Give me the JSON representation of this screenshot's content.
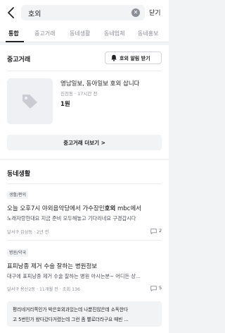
{
  "search": {
    "query": "호외",
    "close_label": "닫기"
  },
  "tabs": [
    {
      "label": "통합",
      "active": true
    },
    {
      "label": "중고거래",
      "active": false
    },
    {
      "label": "동네생활",
      "active": false
    },
    {
      "label": "동네업체",
      "active": false
    },
    {
      "label": "동네홍보",
      "active": false
    }
  ],
  "used_trade": {
    "section_title": "중고거래",
    "alert_button": "호외 알림 받기",
    "item": {
      "title": "영남일보, 동아일보 호외 삽니다",
      "meta": "진천동 · 17시간 전",
      "price": "1원"
    },
    "more_button": "중고거래 더보기 >"
  },
  "community": {
    "section_title": "동네생활",
    "posts": [
      {
        "badge": "생활/편의",
        "title_before": "오늘 오후7시 야외음악당에서 가수장민",
        "title_keyword": "호외",
        "title_after": " mbc에서",
        "body": "노래자랑한대요 지금 준비 모두해놓고 기다리네요 구경갑시다",
        "meta": "달서구 감삼동 · 2년 전",
        "comments": "2"
      },
      {
        "badge": "병원/약국",
        "title": "표피낭종 제거 수술 잘하는 병원정보",
        "body": "대구에 표피낭종 제거 수술 잘하는 병원 아시는분~ 어디든 상...",
        "meta": "달서구 용산2동 · 11개월 전 · 조회 136",
        "comments": "5"
      }
    ],
    "snippet_lines": [
      "평리네거리쪽인가 박은호외과있는데 나뿐진않은데 소독한다",
      "고 5번인가 왔다갔다거렸는데 그런 좀 빨로더라구요 때빈 ..."
    ]
  },
  "colors": {
    "accent": "#212124",
    "muted": "#8b8e94",
    "bg": "#f2f3f5"
  },
  "icons": [
    "back-arrow-icon",
    "clear-icon",
    "bell-icon",
    "tag-placeholder-icon",
    "chevron-right-icon",
    "comment-icon"
  ]
}
